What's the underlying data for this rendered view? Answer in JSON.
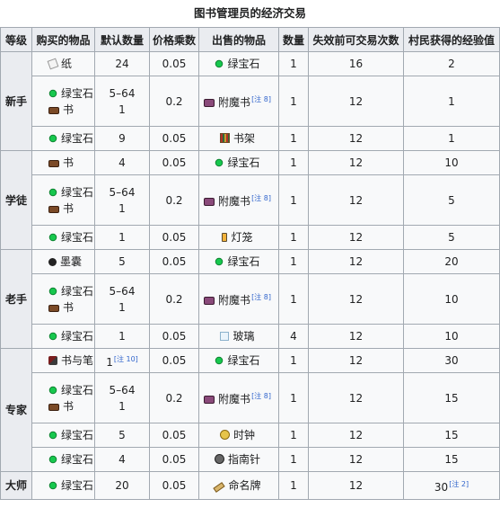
{
  "caption": "图书管理员的经济交易",
  "headers": [
    "等级",
    "购买的物品",
    "默认数量",
    "价格乘数",
    "出售的物品",
    "数量",
    "失效前可交易次数",
    "村民获得的经验值"
  ],
  "levels": [
    {
      "name": "新手",
      "trades": [
        {
          "buy": [
            {
              "icon": "paper-icon",
              "cls": "paper",
              "label": "纸"
            }
          ],
          "qty": [
            "24"
          ],
          "mult": "0.05",
          "sell": {
            "icon": "emerald-icon",
            "cls": "emerald",
            "label": "绿宝石"
          },
          "sellQty": "1",
          "uses": "16",
          "xp": "2",
          "h": "r1"
        },
        {
          "buy": [
            {
              "icon": "emerald-icon",
              "cls": "emerald",
              "label": "绿宝石"
            },
            {
              "icon": "book-icon",
              "cls": "book",
              "label": "书"
            }
          ],
          "qty": [
            "5–64",
            "1"
          ],
          "mult": "0.2",
          "sell": {
            "icon": "enchanted-book-icon",
            "cls": "ebook",
            "label": "附魔书",
            "note": "[注 8]"
          },
          "sellQty": "1",
          "uses": "12",
          "xp": "1",
          "h": "r2"
        },
        {
          "buy": [
            {
              "icon": "emerald-icon",
              "cls": "emerald",
              "label": "绿宝石"
            }
          ],
          "qty": [
            "9"
          ],
          "mult": "0.05",
          "sell": {
            "icon": "bookshelf-icon",
            "cls": "shelf",
            "label": "书架"
          },
          "sellQty": "1",
          "uses": "12",
          "xp": "1",
          "h": "r1"
        }
      ]
    },
    {
      "name": "学徒",
      "trades": [
        {
          "buy": [
            {
              "icon": "book-icon",
              "cls": "book",
              "label": "书"
            }
          ],
          "qty": [
            "4"
          ],
          "mult": "0.05",
          "sell": {
            "icon": "emerald-icon",
            "cls": "emerald",
            "label": "绿宝石"
          },
          "sellQty": "1",
          "uses": "12",
          "xp": "10",
          "h": "r1"
        },
        {
          "buy": [
            {
              "icon": "emerald-icon",
              "cls": "emerald",
              "label": "绿宝石"
            },
            {
              "icon": "book-icon",
              "cls": "book",
              "label": "书"
            }
          ],
          "qty": [
            "5–64",
            "1"
          ],
          "mult": "0.2",
          "sell": {
            "icon": "enchanted-book-icon",
            "cls": "ebook",
            "label": "附魔书",
            "note": "[注 8]"
          },
          "sellQty": "1",
          "uses": "12",
          "xp": "5",
          "h": "r2"
        },
        {
          "buy": [
            {
              "icon": "emerald-icon",
              "cls": "emerald",
              "label": "绿宝石"
            }
          ],
          "qty": [
            "1"
          ],
          "mult": "0.05",
          "sell": {
            "icon": "lantern-icon",
            "cls": "lantern",
            "label": "灯笼"
          },
          "sellQty": "1",
          "uses": "12",
          "xp": "5",
          "h": "r1"
        }
      ]
    },
    {
      "name": "老手",
      "trades": [
        {
          "buy": [
            {
              "icon": "ink-sac-icon",
              "cls": "ink",
              "label": "墨囊"
            }
          ],
          "qty": [
            "5"
          ],
          "mult": "0.05",
          "sell": {
            "icon": "emerald-icon",
            "cls": "emerald",
            "label": "绿宝石"
          },
          "sellQty": "1",
          "uses": "12",
          "xp": "20",
          "h": "r1"
        },
        {
          "buy": [
            {
              "icon": "emerald-icon",
              "cls": "emerald",
              "label": "绿宝石"
            },
            {
              "icon": "book-icon",
              "cls": "book",
              "label": "书"
            }
          ],
          "qty": [
            "5–64",
            "1"
          ],
          "mult": "0.2",
          "sell": {
            "icon": "enchanted-book-icon",
            "cls": "ebook",
            "label": "附魔书",
            "note": "[注 8]"
          },
          "sellQty": "1",
          "uses": "12",
          "xp": "10",
          "h": "r2"
        },
        {
          "buy": [
            {
              "icon": "emerald-icon",
              "cls": "emerald",
              "label": "绿宝石"
            }
          ],
          "qty": [
            "1"
          ],
          "mult": "0.05",
          "sell": {
            "icon": "glass-icon",
            "cls": "glass",
            "label": "玻璃"
          },
          "sellQty": "4",
          "uses": "12",
          "xp": "10",
          "h": "r1"
        }
      ]
    },
    {
      "name": "专家",
      "trades": [
        {
          "buy": [
            {
              "icon": "book-and-quill-icon",
              "cls": "quill",
              "label": "书与笔"
            }
          ],
          "qty": [
            "1"
          ],
          "qtyNote": "[注 10]",
          "mult": "0.05",
          "sell": {
            "icon": "emerald-icon",
            "cls": "emerald",
            "label": "绿宝石"
          },
          "sellQty": "1",
          "uses": "12",
          "xp": "30",
          "h": "r1"
        },
        {
          "buy": [
            {
              "icon": "emerald-icon",
              "cls": "emerald",
              "label": "绿宝石"
            },
            {
              "icon": "book-icon",
              "cls": "book",
              "label": "书"
            }
          ],
          "qty": [
            "5–64",
            "1"
          ],
          "mult": "0.2",
          "sell": {
            "icon": "enchanted-book-icon",
            "cls": "ebook",
            "label": "附魔书",
            "note": "[注 8]"
          },
          "sellQty": "1",
          "uses": "12",
          "xp": "15",
          "h": "r2"
        },
        {
          "buy": [
            {
              "icon": "emerald-icon",
              "cls": "emerald",
              "label": "绿宝石"
            }
          ],
          "qty": [
            "5"
          ],
          "mult": "0.05",
          "sell": {
            "icon": "clock-icon",
            "cls": "clock",
            "label": "时钟"
          },
          "sellQty": "1",
          "uses": "12",
          "xp": "15",
          "h": "r1"
        },
        {
          "buy": [
            {
              "icon": "emerald-icon",
              "cls": "emerald",
              "label": "绿宝石"
            }
          ],
          "qty": [
            "4"
          ],
          "mult": "0.05",
          "sell": {
            "icon": "compass-icon",
            "cls": "compass",
            "label": "指南针"
          },
          "sellQty": "1",
          "uses": "12",
          "xp": "15",
          "h": "r1"
        }
      ]
    },
    {
      "name": "大师",
      "trades": [
        {
          "buy": [
            {
              "icon": "emerald-icon",
              "cls": "emerald",
              "label": "绿宝石"
            }
          ],
          "qty": [
            "20"
          ],
          "mult": "0.05",
          "sell": {
            "icon": "name-tag-icon",
            "cls": "tag",
            "label": "命名牌"
          },
          "sellQty": "1",
          "uses": "12",
          "xp": "30",
          "xpNote": "[注 2]",
          "h": "r3"
        }
      ]
    }
  ]
}
